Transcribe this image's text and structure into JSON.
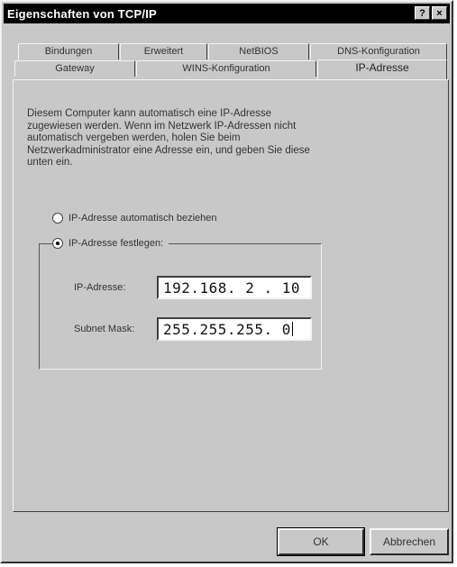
{
  "window": {
    "title": "Eigenschaften von TCP/IP",
    "help_label": "?",
    "close_label": "×"
  },
  "tabs": {
    "back_row": [
      {
        "label": "Bindungen"
      },
      {
        "label": "Erweitert"
      },
      {
        "label": "NetBIOS"
      },
      {
        "label": "DNS-Konfiguration"
      }
    ],
    "front_row": [
      {
        "label": "Gateway"
      },
      {
        "label": "WINS-Konfiguration"
      },
      {
        "label": "IP-Adresse",
        "active": true
      }
    ]
  },
  "description": [
    "Diesem Computer kann automatisch eine IP-Adresse",
    "zugewiesen werden. Wenn im Netzwerk IP-Adressen nicht",
    "automatisch vergeben werden, holen Sie beim",
    "Netzwerkadministrator eine Adresse ein, und geben Sie diese",
    "unten ein."
  ],
  "options": {
    "auto": {
      "label": "IP-Adresse automatisch beziehen",
      "checked": false
    },
    "manual": {
      "label": "IP-Adresse festlegen:",
      "checked": true
    }
  },
  "fields": {
    "ip_label": "IP-Adresse:",
    "ip_value": "192.168. 2 . 10",
    "subnet_label": "Subnet Mask:",
    "subnet_value": "255.255.255. 0"
  },
  "buttons": {
    "ok": "OK",
    "cancel": "Abbrechen"
  }
}
